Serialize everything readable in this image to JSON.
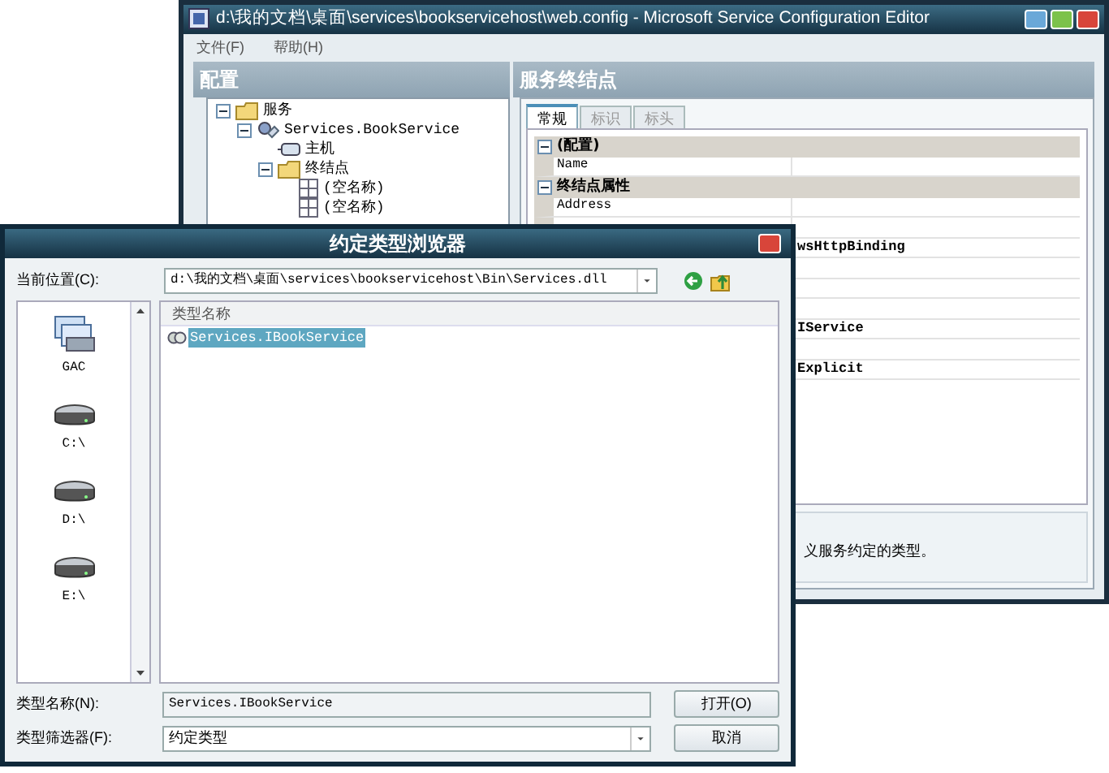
{
  "editor": {
    "window": {
      "title": "d:\\我的文档\\桌面\\services\\bookservicehost\\web.config - Microsoft Service Configuration Editor"
    },
    "menu": [
      "文件(F)",
      "帮助(H)"
    ],
    "left_panel": {
      "title": "配置",
      "tree": [
        {
          "label": "服务",
          "kind": "folder",
          "expanded": true,
          "children": [
            {
              "label": "Services.BookService",
              "kind": "service",
              "expanded": true,
              "children": [
                {
                  "label": "主机",
                  "kind": "host"
                },
                {
                  "label": "终结点",
                  "kind": "folder",
                  "expanded": true,
                  "children": [
                    {
                      "label": "(空名称)",
                      "kind": "endpoint"
                    },
                    {
                      "label": "(空名称)",
                      "kind": "endpoint"
                    }
                  ]
                }
              ]
            }
          ]
        }
      ]
    },
    "right_panel": {
      "title": "服务终结点",
      "tabs": [
        {
          "label": "常规",
          "selected": true
        },
        {
          "label": "标识",
          "selected": false
        },
        {
          "label": "标头",
          "selected": false
        }
      ],
      "grid": [
        {
          "kind": "category",
          "name": "(配置)",
          "expanded": true
        },
        {
          "kind": "property",
          "name": "Name"
        },
        {
          "kind": "category",
          "name": "终结点属性",
          "expanded": true
        },
        {
          "kind": "property",
          "name": "Address"
        },
        {
          "kind": "property"
        },
        {
          "kind": "property",
          "value": "wsHttpBinding"
        },
        {
          "kind": "property"
        },
        {
          "kind": "property"
        },
        {
          "kind": "property"
        },
        {
          "kind": "property",
          "value": "IService"
        },
        {
          "kind": "property"
        },
        {
          "kind": "property",
          "value": "Explicit"
        }
      ],
      "description": "义服务约定的类型。"
    }
  },
  "dialog": {
    "window": {
      "title": "约定类型浏览器"
    },
    "location": {
      "label": "当前位置(C):",
      "value": "d:\\我的文档\\桌面\\services\\bookservicehost\\Bin\\Services.dll"
    },
    "places": [
      {
        "label": "GAC",
        "kind": "gac"
      },
      {
        "label": "C:\\",
        "kind": "drive"
      },
      {
        "label": "D:\\",
        "kind": "drive"
      },
      {
        "label": "E:\\",
        "kind": "drive"
      }
    ],
    "list": {
      "column": "类型名称",
      "items": [
        {
          "label": "Services.IBookService",
          "selected": true
        }
      ]
    },
    "type_name": {
      "label": "类型名称(N):",
      "value": "Services.IBookService"
    },
    "type_filter": {
      "label": "类型筛选器(F):",
      "value": "约定类型"
    },
    "buttons": [
      "打开(O)",
      "取消"
    ]
  }
}
